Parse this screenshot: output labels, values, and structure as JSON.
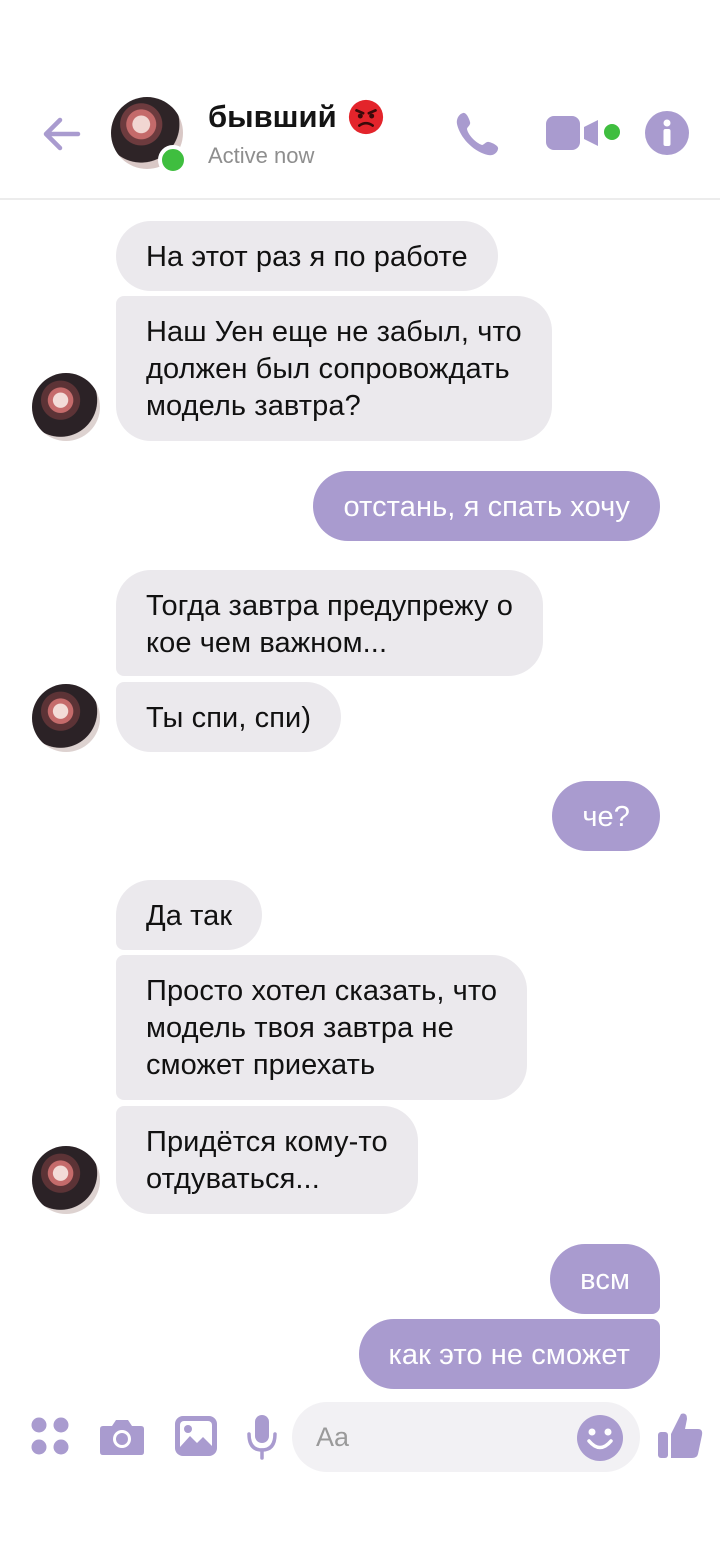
{
  "header": {
    "contact_name": "бывший",
    "status": "Active now",
    "accent_color": "#a99bcf",
    "online_color": "#3fbe3f"
  },
  "messages": [
    {
      "side": "in",
      "text": "На этот раз я по работе"
    },
    {
      "side": "in",
      "text": "Наш Уен еще не забыл, что\nдолжен был сопровождать\nмодель завтра?"
    },
    {
      "side": "out",
      "text": "отстань, я спать хочу"
    },
    {
      "side": "in",
      "text": "Тогда завтра предупрежу о\nкое чем важном..."
    },
    {
      "side": "in",
      "text": "Ты спи, спи)"
    },
    {
      "side": "out",
      "text": "че?"
    },
    {
      "side": "in",
      "text": "Да так"
    },
    {
      "side": "in",
      "text": "Просто хотел сказать, что\nмодель твоя завтра не\nсможет приехать"
    },
    {
      "side": "in",
      "text": "Придётся кому-то\nотдуваться..."
    },
    {
      "side": "out",
      "text": "всм"
    },
    {
      "side": "out",
      "text": "как это не сможет"
    }
  ],
  "composer": {
    "placeholder": "Aa",
    "icons": [
      "apps-icon",
      "camera-icon",
      "gallery-icon",
      "microphone-icon",
      "emoji-icon",
      "thumbs-up-icon"
    ]
  }
}
